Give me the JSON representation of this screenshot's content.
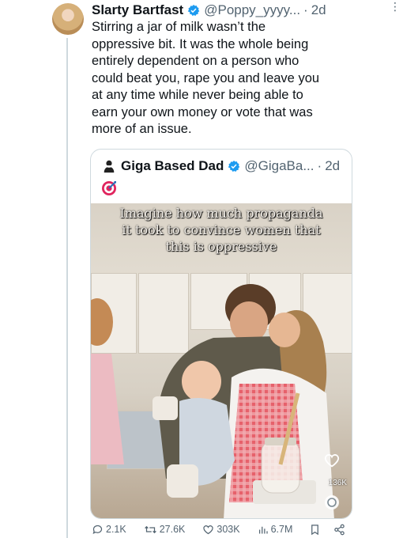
{
  "tweet": {
    "display_name": "Slarty Bartfast",
    "handle": "@Poppy_yyyy...",
    "separator": "·",
    "time": "2d",
    "text_lines": [
      "Stirring a jar of milk wasn’t the",
      "oppressive bit. It was the whole being",
      "entirely dependent on a person who",
      "could beat you, rape you and leave you",
      "at any time while never being able to",
      "earn your own money or vote that was",
      "more of an issue."
    ]
  },
  "quoted": {
    "display_name": "Giga Based Dad",
    "handle": "@GigaBa...",
    "separator": "·",
    "time": "2d",
    "emoji_icon": "target-emoji-icon",
    "video": {
      "caption_lines": [
        "Imagine how much propaganda",
        "it took to convince women that",
        "this is oppressive"
      ],
      "like_count": "136K"
    }
  },
  "actions": {
    "replies": "2.1K",
    "reposts": "27.6K",
    "likes": "303K",
    "views": "6.7M"
  },
  "colors": {
    "verified": "#1d9bf0",
    "secondary_text": "#536471",
    "border": "#cfd9de"
  }
}
